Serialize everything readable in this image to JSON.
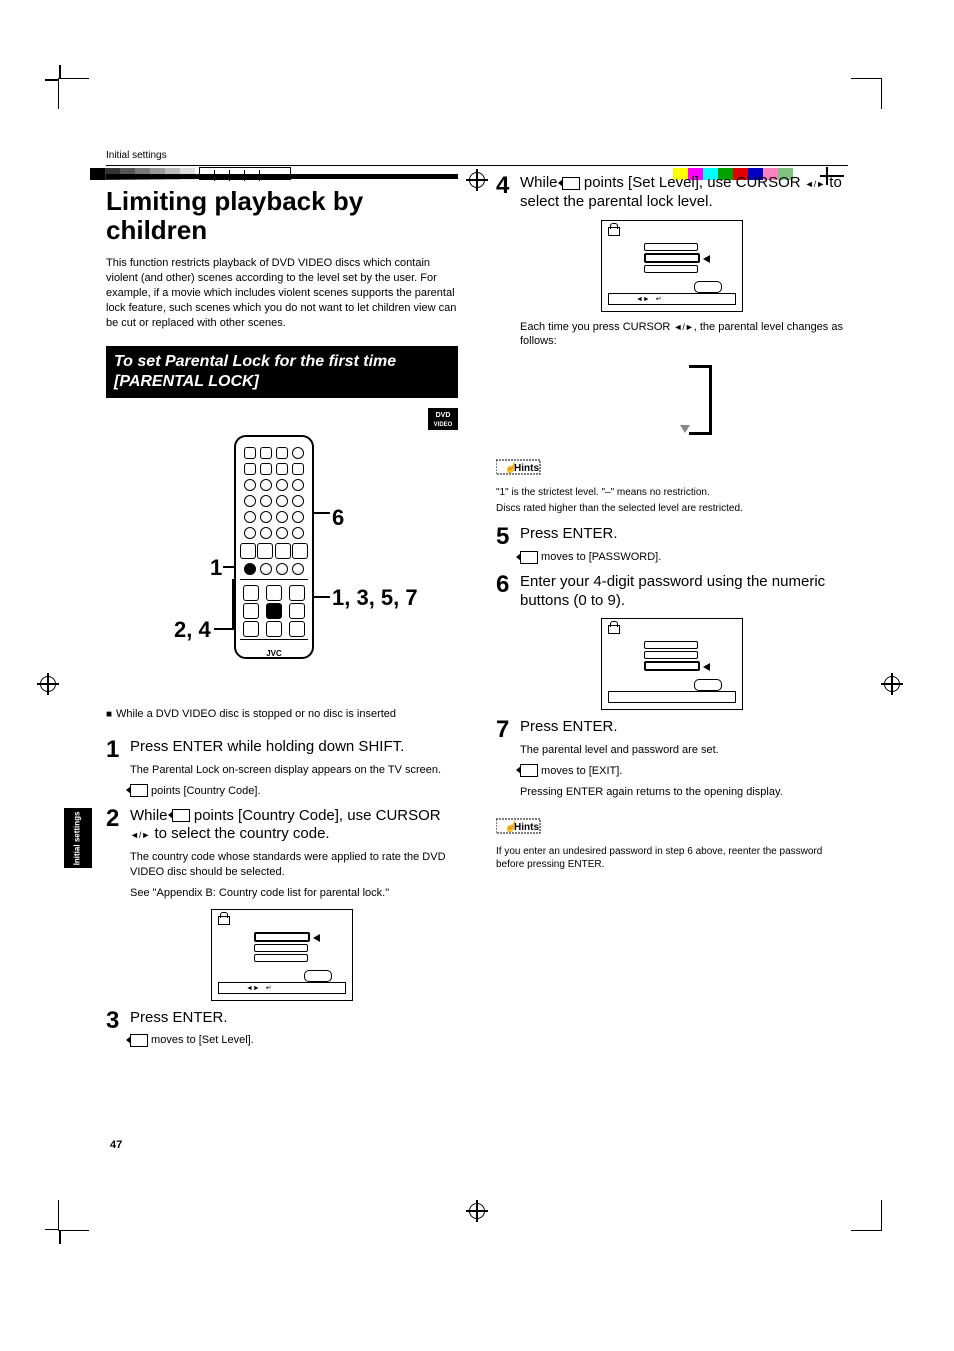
{
  "header": {
    "breadcrumb": "Initial settings"
  },
  "title": "Limiting playback by children",
  "intro": "This function restricts playback of DVD VIDEO discs which contain violent (and other) scenes according to the level set by the user. For example, if a movie which includes violent scenes supports the parental lock feature, such scenes which you do not want to let children view can be cut or replaced with other scenes.",
  "boxTitle": "To set Parental Lock for the first time [PARENTAL LOCK]",
  "remoteFig": {
    "c1": "1",
    "c2": "2, 4",
    "c3": "6",
    "c4": "1, 3, 5, 7",
    "logo": "JVC"
  },
  "preStep": "While a DVD VIDEO disc is stopped or no disc is inserted",
  "step1": {
    "main": "Press ENTER while holding down SHIFT.",
    "sub1": "The Parental Lock on-screen display appears on the TV screen.",
    "sub2": " points [Country Code]."
  },
  "step2": {
    "main_a": "While ",
    "main_b": " points [Country Code], use CURSOR ",
    "main_c": " to select the country code.",
    "sub1": "The country code whose standards were applied to rate the DVD VIDEO disc should be selected.",
    "sub2": "See \"Appendix B: Country code list for parental lock.\""
  },
  "step3": {
    "main": "Press ENTER.",
    "sub1": " moves to [Set Level]."
  },
  "step4": {
    "main_a": "While ",
    "main_b": " points [Set Level], use CURSOR ",
    "main_c": " to select the parental lock level.",
    "sub1_a": "Each time you press  CURSOR ",
    "sub1_b": ", the parental level changes as follows:"
  },
  "hints1": {
    "line1": "\"1\" is the strictest level. \"–\" means no restriction.",
    "line2": "Discs rated higher than the selected level are restricted."
  },
  "step5": {
    "main": "Press ENTER.",
    "sub1": " moves to [PASSWORD]."
  },
  "step6": {
    "main": "Enter your 4-digit password using the numeric buttons (0 to 9)."
  },
  "step7": {
    "main": "Press ENTER.",
    "sub1": "The parental level and password are set.",
    "sub2": " moves to [EXIT].",
    "sub3": "Pressing ENTER again returns to the opening display."
  },
  "hints2": "If you enter an undesired password in step 6 above, reenter the password before pressing ENTER.",
  "sideTab": "Initial\nsettings",
  "pageNum": "47",
  "dvdBadge": {
    "line1": "DVD",
    "line2": "VIDEO"
  },
  "hintsLabel": "Hints",
  "arrows": "◄/►"
}
